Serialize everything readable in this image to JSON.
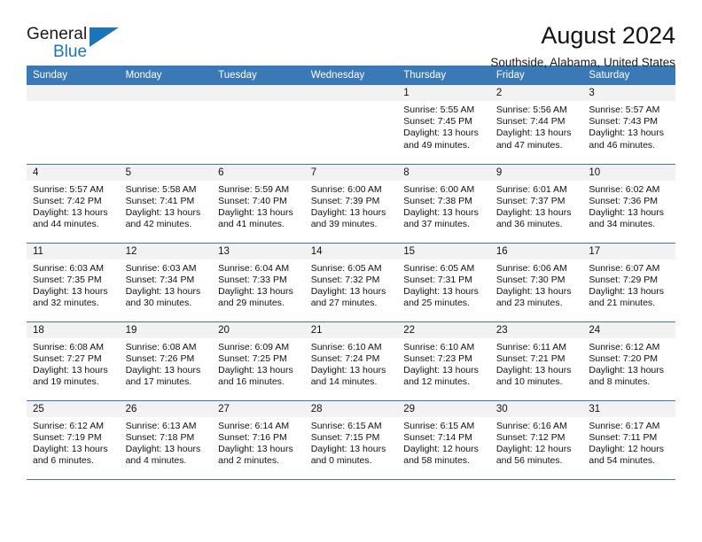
{
  "brand": {
    "word_one": "General",
    "word_two": "Blue",
    "logo_icon": "triangle-logo-icon"
  },
  "header": {
    "title": "August 2024",
    "subtitle": "Southside, Alabama, United States"
  },
  "colors": {
    "header_blue": "#3b78b6",
    "daynum_gray": "#f2f2f2",
    "brand_blue": "#1b75bb"
  },
  "weekday_headers": [
    "Sunday",
    "Monday",
    "Tuesday",
    "Wednesday",
    "Thursday",
    "Friday",
    "Saturday"
  ],
  "labels": {
    "sunrise_prefix": "Sunrise:",
    "sunset_prefix": "Sunset:",
    "daylight_prefix": "Daylight:"
  },
  "weeks": [
    [
      {
        "day": "",
        "blank": true,
        "line1": "",
        "line2": "",
        "line3": "",
        "line4": ""
      },
      {
        "day": "",
        "blank": true,
        "line1": "",
        "line2": "",
        "line3": "",
        "line4": ""
      },
      {
        "day": "",
        "blank": true,
        "line1": "",
        "line2": "",
        "line3": "",
        "line4": ""
      },
      {
        "day": "",
        "blank": true,
        "line1": "",
        "line2": "",
        "line3": "",
        "line4": ""
      },
      {
        "day": "1",
        "blank": false,
        "line1": "Sunrise: 5:55 AM",
        "line2": "Sunset: 7:45 PM",
        "line3": "Daylight: 13 hours",
        "line4": "and 49 minutes."
      },
      {
        "day": "2",
        "blank": false,
        "line1": "Sunrise: 5:56 AM",
        "line2": "Sunset: 7:44 PM",
        "line3": "Daylight: 13 hours",
        "line4": "and 47 minutes."
      },
      {
        "day": "3",
        "blank": false,
        "line1": "Sunrise: 5:57 AM",
        "line2": "Sunset: 7:43 PM",
        "line3": "Daylight: 13 hours",
        "line4": "and 46 minutes."
      }
    ],
    [
      {
        "day": "4",
        "blank": false,
        "line1": "Sunrise: 5:57 AM",
        "line2": "Sunset: 7:42 PM",
        "line3": "Daylight: 13 hours",
        "line4": "and 44 minutes."
      },
      {
        "day": "5",
        "blank": false,
        "line1": "Sunrise: 5:58 AM",
        "line2": "Sunset: 7:41 PM",
        "line3": "Daylight: 13 hours",
        "line4": "and 42 minutes."
      },
      {
        "day": "6",
        "blank": false,
        "line1": "Sunrise: 5:59 AM",
        "line2": "Sunset: 7:40 PM",
        "line3": "Daylight: 13 hours",
        "line4": "and 41 minutes."
      },
      {
        "day": "7",
        "blank": false,
        "line1": "Sunrise: 6:00 AM",
        "line2": "Sunset: 7:39 PM",
        "line3": "Daylight: 13 hours",
        "line4": "and 39 minutes."
      },
      {
        "day": "8",
        "blank": false,
        "line1": "Sunrise: 6:00 AM",
        "line2": "Sunset: 7:38 PM",
        "line3": "Daylight: 13 hours",
        "line4": "and 37 minutes."
      },
      {
        "day": "9",
        "blank": false,
        "line1": "Sunrise: 6:01 AM",
        "line2": "Sunset: 7:37 PM",
        "line3": "Daylight: 13 hours",
        "line4": "and 36 minutes."
      },
      {
        "day": "10",
        "blank": false,
        "line1": "Sunrise: 6:02 AM",
        "line2": "Sunset: 7:36 PM",
        "line3": "Daylight: 13 hours",
        "line4": "and 34 minutes."
      }
    ],
    [
      {
        "day": "11",
        "blank": false,
        "line1": "Sunrise: 6:03 AM",
        "line2": "Sunset: 7:35 PM",
        "line3": "Daylight: 13 hours",
        "line4": "and 32 minutes."
      },
      {
        "day": "12",
        "blank": false,
        "line1": "Sunrise: 6:03 AM",
        "line2": "Sunset: 7:34 PM",
        "line3": "Daylight: 13 hours",
        "line4": "and 30 minutes."
      },
      {
        "day": "13",
        "blank": false,
        "line1": "Sunrise: 6:04 AM",
        "line2": "Sunset: 7:33 PM",
        "line3": "Daylight: 13 hours",
        "line4": "and 29 minutes."
      },
      {
        "day": "14",
        "blank": false,
        "line1": "Sunrise: 6:05 AM",
        "line2": "Sunset: 7:32 PM",
        "line3": "Daylight: 13 hours",
        "line4": "and 27 minutes."
      },
      {
        "day": "15",
        "blank": false,
        "line1": "Sunrise: 6:05 AM",
        "line2": "Sunset: 7:31 PM",
        "line3": "Daylight: 13 hours",
        "line4": "and 25 minutes."
      },
      {
        "day": "16",
        "blank": false,
        "line1": "Sunrise: 6:06 AM",
        "line2": "Sunset: 7:30 PM",
        "line3": "Daylight: 13 hours",
        "line4": "and 23 minutes."
      },
      {
        "day": "17",
        "blank": false,
        "line1": "Sunrise: 6:07 AM",
        "line2": "Sunset: 7:29 PM",
        "line3": "Daylight: 13 hours",
        "line4": "and 21 minutes."
      }
    ],
    [
      {
        "day": "18",
        "blank": false,
        "line1": "Sunrise: 6:08 AM",
        "line2": "Sunset: 7:27 PM",
        "line3": "Daylight: 13 hours",
        "line4": "and 19 minutes."
      },
      {
        "day": "19",
        "blank": false,
        "line1": "Sunrise: 6:08 AM",
        "line2": "Sunset: 7:26 PM",
        "line3": "Daylight: 13 hours",
        "line4": "and 17 minutes."
      },
      {
        "day": "20",
        "blank": false,
        "line1": "Sunrise: 6:09 AM",
        "line2": "Sunset: 7:25 PM",
        "line3": "Daylight: 13 hours",
        "line4": "and 16 minutes."
      },
      {
        "day": "21",
        "blank": false,
        "line1": "Sunrise: 6:10 AM",
        "line2": "Sunset: 7:24 PM",
        "line3": "Daylight: 13 hours",
        "line4": "and 14 minutes."
      },
      {
        "day": "22",
        "blank": false,
        "line1": "Sunrise: 6:10 AM",
        "line2": "Sunset: 7:23 PM",
        "line3": "Daylight: 13 hours",
        "line4": "and 12 minutes."
      },
      {
        "day": "23",
        "blank": false,
        "line1": "Sunrise: 6:11 AM",
        "line2": "Sunset: 7:21 PM",
        "line3": "Daylight: 13 hours",
        "line4": "and 10 minutes."
      },
      {
        "day": "24",
        "blank": false,
        "line1": "Sunrise: 6:12 AM",
        "line2": "Sunset: 7:20 PM",
        "line3": "Daylight: 13 hours",
        "line4": "and 8 minutes."
      }
    ],
    [
      {
        "day": "25",
        "blank": false,
        "line1": "Sunrise: 6:12 AM",
        "line2": "Sunset: 7:19 PM",
        "line3": "Daylight: 13 hours",
        "line4": "and 6 minutes."
      },
      {
        "day": "26",
        "blank": false,
        "line1": "Sunrise: 6:13 AM",
        "line2": "Sunset: 7:18 PM",
        "line3": "Daylight: 13 hours",
        "line4": "and 4 minutes."
      },
      {
        "day": "27",
        "blank": false,
        "line1": "Sunrise: 6:14 AM",
        "line2": "Sunset: 7:16 PM",
        "line3": "Daylight: 13 hours",
        "line4": "and 2 minutes."
      },
      {
        "day": "28",
        "blank": false,
        "line1": "Sunrise: 6:15 AM",
        "line2": "Sunset: 7:15 PM",
        "line3": "Daylight: 13 hours",
        "line4": "and 0 minutes."
      },
      {
        "day": "29",
        "blank": false,
        "line1": "Sunrise: 6:15 AM",
        "line2": "Sunset: 7:14 PM",
        "line3": "Daylight: 12 hours",
        "line4": "and 58 minutes."
      },
      {
        "day": "30",
        "blank": false,
        "line1": "Sunrise: 6:16 AM",
        "line2": "Sunset: 7:12 PM",
        "line3": "Daylight: 12 hours",
        "line4": "and 56 minutes."
      },
      {
        "day": "31",
        "blank": false,
        "line1": "Sunrise: 6:17 AM",
        "line2": "Sunset: 7:11 PM",
        "line3": "Daylight: 12 hours",
        "line4": "and 54 minutes."
      }
    ]
  ]
}
